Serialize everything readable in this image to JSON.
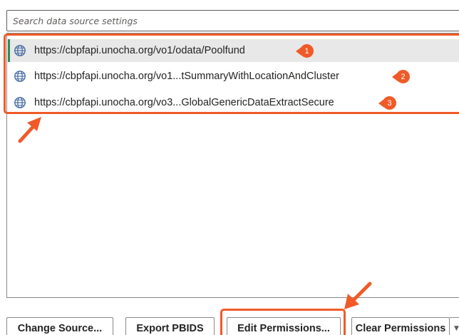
{
  "search": {
    "placeholder": "Search data source settings",
    "value": ""
  },
  "data_sources": [
    {
      "url": "https://cbpfapi.unocha.org/vo1/odata/Poolfund",
      "icon": "globe-icon",
      "selected": true,
      "badge": "1"
    },
    {
      "url": "https://cbpfapi.unocha.org/vo1...tSummaryWithLocationAndCluster",
      "icon": "globe-icon",
      "selected": false,
      "badge": "2"
    },
    {
      "url": "https://cbpfapi.unocha.org/vo3...GlobalGenericDataExtractSecure",
      "icon": "globe-icon",
      "selected": false,
      "badge": "3"
    }
  ],
  "buttons": {
    "change_source": "Change Source...",
    "export_pbids": "Export PBIDS",
    "edit_permissions": "Edit Permissions...",
    "clear_permissions": "Clear Permissions"
  },
  "colors": {
    "annotation": "#f05a28",
    "selected_row_bg": "#e8e8e8",
    "selected_row_accent": "#2e8b57",
    "globe": "#4a6fa5"
  }
}
